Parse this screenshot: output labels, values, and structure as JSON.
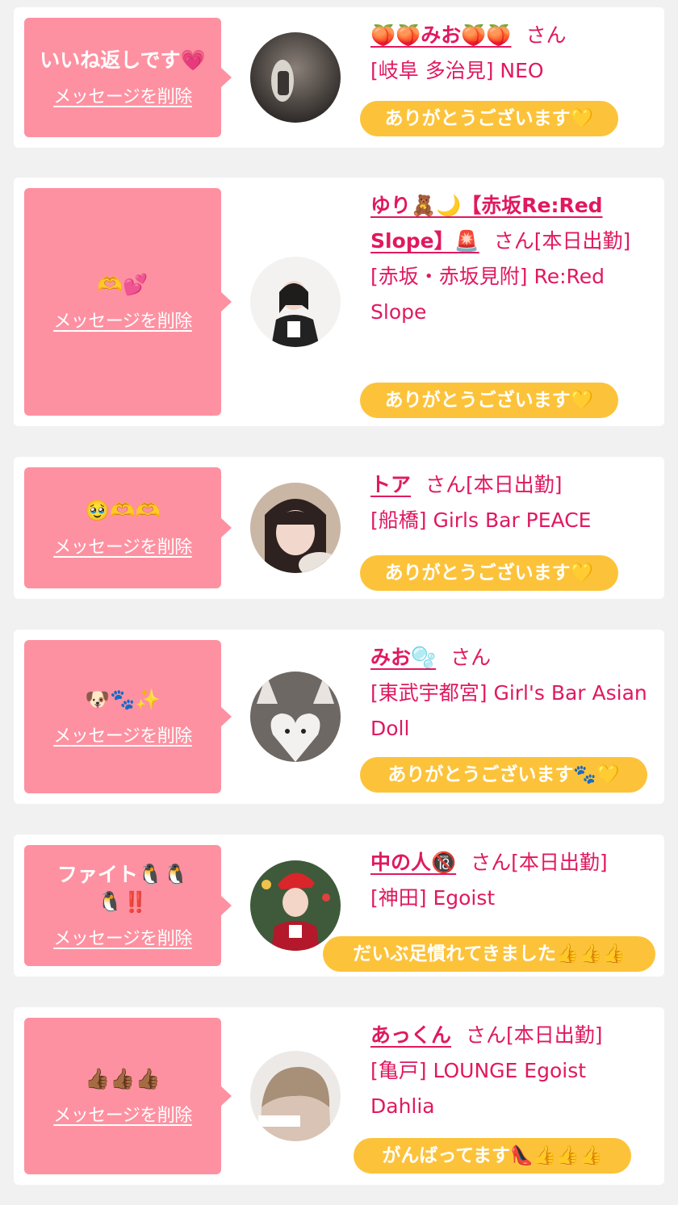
{
  "delete_label": "メッセージを削除",
  "san_suffix": "さん",
  "items": [
    {
      "message": "いいね返しです💗",
      "name": "🍑🍑みお🍑🍑",
      "status": "",
      "shop": "[岐阜 多治見] NEO",
      "reply": "ありがとうございます💛"
    },
    {
      "message": "🫶💕",
      "name": "ゆり🧸🌙【赤坂Re:Red Slope】🚨",
      "status": "[本日出勤]",
      "shop": "[赤坂・赤坂見附] Re:Red Slope",
      "reply": "ありがとうございます💛"
    },
    {
      "message": "🥹🫶🫶",
      "name": "トア",
      "status": "[本日出勤]",
      "shop": "[船橋] Girls Bar PEACE",
      "reply": "ありがとうございます💛"
    },
    {
      "message": "🐶🐾✨",
      "name": "みお🫧",
      "status": "",
      "shop": "[東武宇都宮] Girl's Bar Asian Doll",
      "reply": "ありがとうございます🐾💛"
    },
    {
      "message": "ファイト🐧🐧🐧‼️",
      "name": "中の人🔞",
      "status": "[本日出勤]",
      "shop": "[神田] Egoist",
      "reply": "だいぶ足慣れてきました👍👍👍"
    },
    {
      "message": "👍🏾👍🏾👍🏾",
      "name": "あっくん",
      "status": "[本日出勤]",
      "shop": "[亀戸] LOUNGE Egoist Dahlia",
      "reply": "がんばってます👠👍👍👍"
    }
  ],
  "colors": {
    "page_bg": "#f1f1f1",
    "card_bg": "#ffffff",
    "bubble": "#fe91a1",
    "accent_text": "#e0195f",
    "reply_pill": "#fcc33a"
  },
  "avatar_icon": "user-photo"
}
